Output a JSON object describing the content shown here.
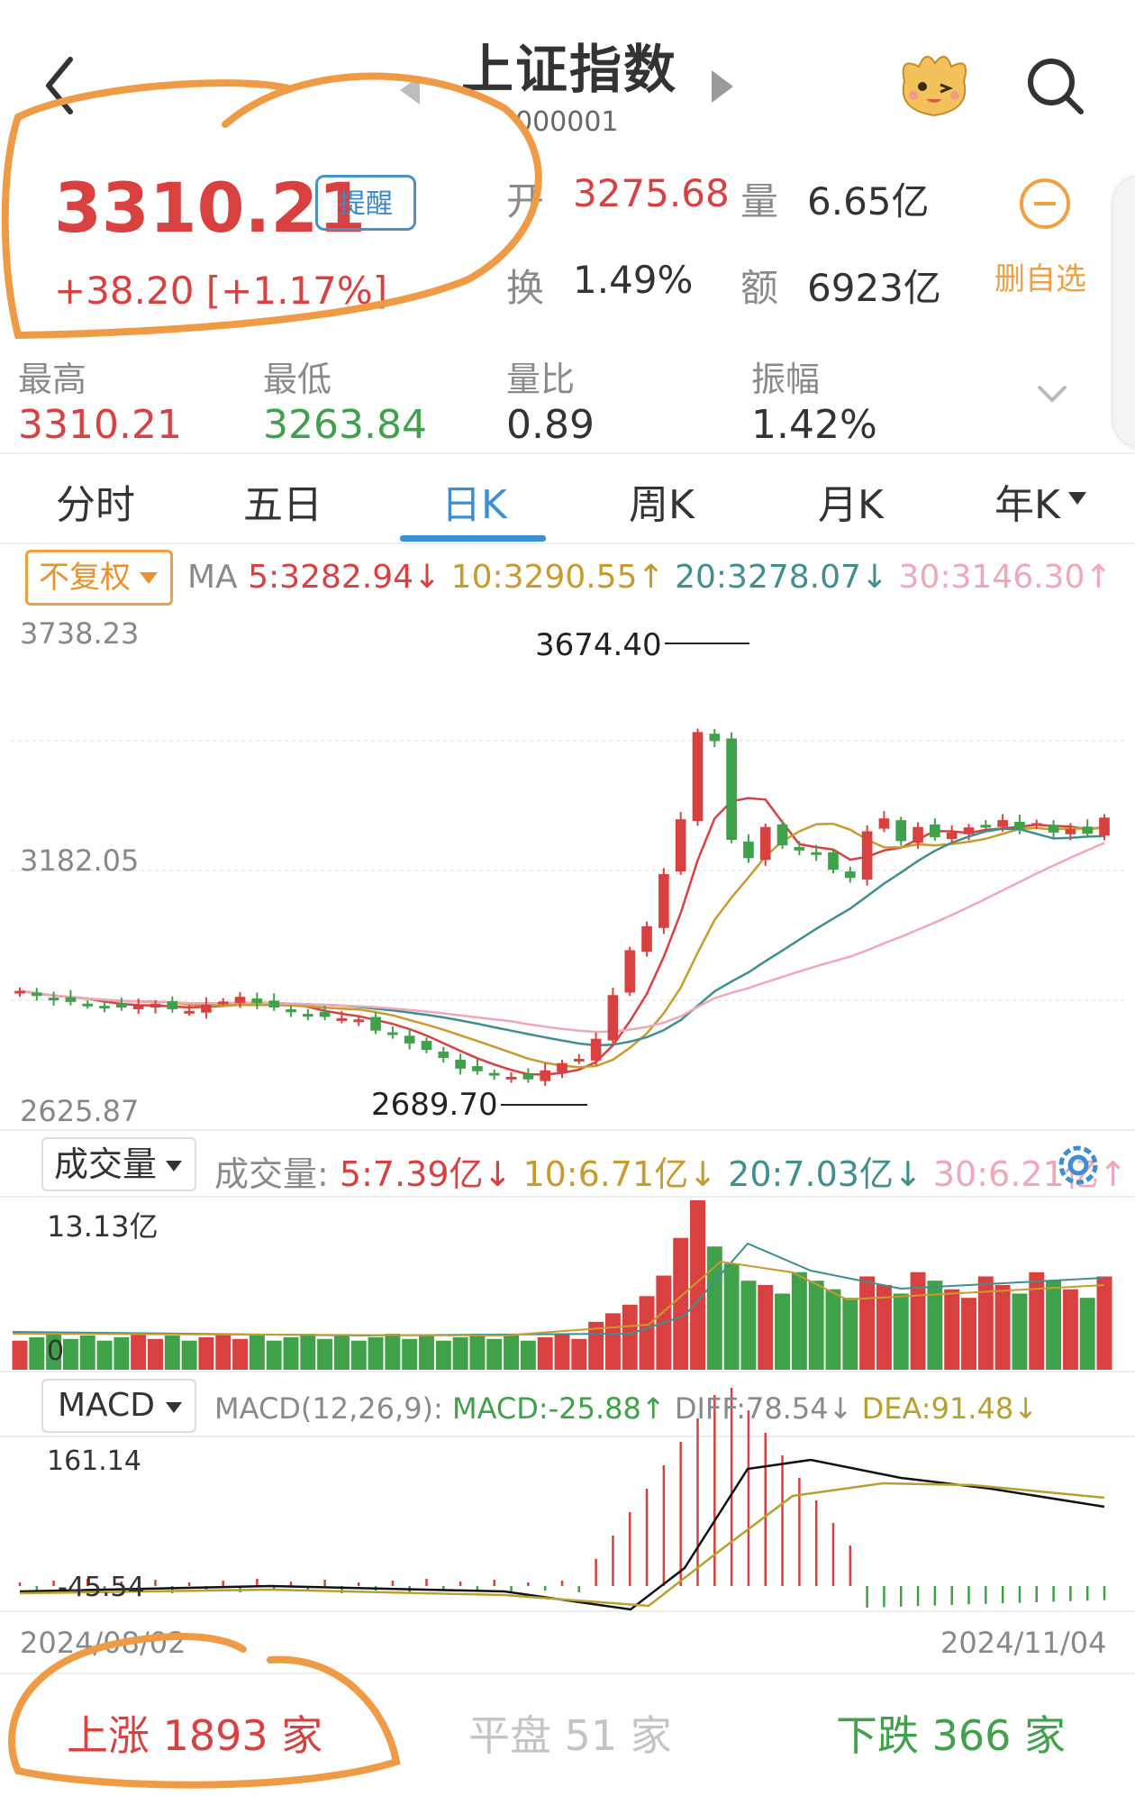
{
  "header": {
    "title": "上证指数",
    "code": "000001"
  },
  "quote": {
    "price": "3310.21",
    "alert_label": "提醒",
    "change": "+38.20  [+1.17%]",
    "open_label": "开",
    "open_value": "3275.68",
    "volume_label": "量",
    "volume_value": "6.65亿",
    "turnover_label": "换",
    "turnover_value": "1.49%",
    "amount_label": "额",
    "amount_value": "6923亿",
    "unwatch_label": "删自选"
  },
  "stats": {
    "high_label": "最高",
    "high_value": "3310.21",
    "low_label": "最低",
    "low_value": "3263.84",
    "vol_ratio_label": "量比",
    "vol_ratio_value": "0.89",
    "amplitude_label": "振幅",
    "amplitude_value": "1.42%"
  },
  "tabs": [
    "分时",
    "五日",
    "日K",
    "周K",
    "月K",
    "年K"
  ],
  "active_tab": "日K",
  "ma_row": {
    "adj_label": "不复权",
    "prefix": "MA ",
    "ma5": "5:3282.94",
    "ma10": "10:3290.55",
    "ma20": "20:3278.07",
    "ma30": "30:3146.30",
    "ma5_dir": "↓",
    "ma10_dir": "↑",
    "ma20_dir": "↓",
    "ma30_dir": "↑"
  },
  "volume_row": {
    "btn_label": "成交量",
    "prefix": "成交量:",
    "v5": "5:7.39亿",
    "v10": "10:6.71亿",
    "v20": "20:7.03亿",
    "v30": "30:6.21亿",
    "v5_dir": "↓",
    "v10_dir": "↓",
    "v20_dir": "↓",
    "v30_dir": "↑"
  },
  "macd_row": {
    "btn_label": "MACD",
    "params": "MACD(12,26,9):",
    "macd": "MACD:-25.88",
    "diff": "DIFF:78.54",
    "dea": "DEA:91.48",
    "macd_dir": "↑",
    "diff_dir": "↓",
    "dea_dir": "↓"
  },
  "axes": {
    "price_max": "3738.23",
    "price_mid": "3182.05",
    "price_min": "2625.87",
    "vol_max": "13.13亿",
    "vol_zero": "0",
    "macd_max": "161.14",
    "macd_min": "-45.54",
    "date_start": "2024/08/02",
    "date_end": "2024/11/04"
  },
  "chart_labels": {
    "high_marker": "3674.40",
    "low_marker": "2689.70"
  },
  "breadth": {
    "up": "上涨 1893 家",
    "flat": "平盘 51 家",
    "down": "下跌 366 家"
  },
  "chart_data": {
    "type": "candlestick",
    "x_range": [
      "2024/08/02",
      "2024/11/04"
    ],
    "ylim": [
      2625.87,
      3738.23
    ],
    "closes": [
      2905,
      2893,
      2884,
      2879,
      2874,
      2869,
      2866,
      2870,
      2875,
      2862,
      2858,
      2873,
      2880,
      2891,
      2876,
      2866,
      2855,
      2850,
      2844,
      2841,
      2838,
      2812,
      2804,
      2782,
      2767,
      2748,
      2723,
      2717,
      2708,
      2704,
      2698,
      2719,
      2736,
      2746,
      2793,
      2895,
      3000,
      3056,
      3178,
      3306,
      3510,
      3489,
      3258,
      3215,
      3288,
      3245,
      3233,
      3223,
      3188,
      3169,
      3278,
      3308,
      3255,
      3288,
      3264,
      3275,
      3287,
      3292,
      3304,
      3285,
      3297,
      3275,
      3283,
      3272,
      3310
    ],
    "volume_max": "13.13亿",
    "macd": {
      "max": 161.14,
      "min": -45.54,
      "diff": 78.54,
      "dea": 91.48,
      "macd": -25.88
    }
  },
  "colors": {
    "up": "#d94040",
    "down": "#3fa14a",
    "accent": "#3b8fd4",
    "ma5": "#d94040",
    "ma10": "#c99a2e",
    "ma20": "#3f8f8f",
    "ma30": "#f0a8b8"
  }
}
